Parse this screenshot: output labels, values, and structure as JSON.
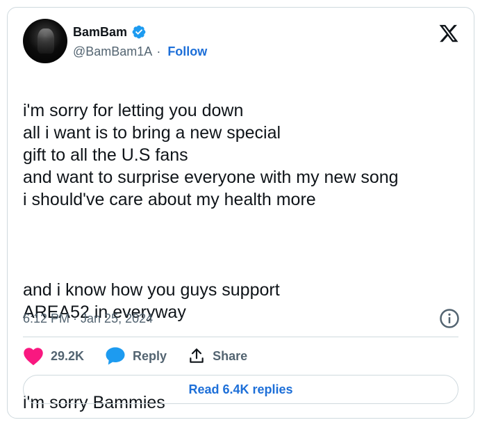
{
  "author": {
    "name": "BamBam",
    "handle": "@BamBam1A",
    "separator": "·",
    "follow_label": "Follow",
    "verified_color": "#1d9bf0"
  },
  "tweet": {
    "lines_p1": "i'm sorry for letting you down\nall i want is to bring a new special\ngift to all the U.S fans\nand want to surprise everyone with my new song\ni should've care about my health more",
    "lines_p2": "and i know how you guys support\nAREA52 in everyway",
    "lines_p3": "i'm sorry Bammies",
    "timestamp": "6:12 PM · Jan 25, 2024"
  },
  "actions": {
    "likes": "29.2K",
    "reply_label": "Reply",
    "share_label": "Share",
    "read_replies_label": "Read 6.4K replies"
  },
  "icons": {
    "platform_logo": "x-logo-icon",
    "like": "heart-icon",
    "reply": "speech-bubble-icon",
    "share": "share-arrow-icon",
    "info": "info-icon"
  },
  "colors": {
    "heart": "#f91880",
    "reply_bubble": "#1d9bf0",
    "link": "#1d6fd8"
  }
}
